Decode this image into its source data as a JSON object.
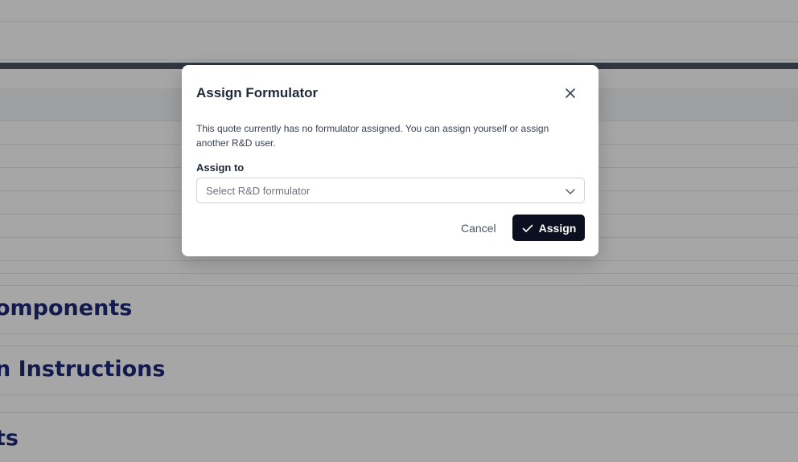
{
  "background": {
    "section_headings": [
      "omponents",
      "n Instructions",
      "ts"
    ]
  },
  "modal": {
    "title": "Assign Formulator",
    "description": "This quote currently has no formulator assigned. You can assign yourself or assign another R&D user.",
    "field_label": "Assign to",
    "select_placeholder": "Select R&D formulator",
    "cancel_label": "Cancel",
    "assign_label": "Assign",
    "close_icon": "close-icon",
    "chevron_icon": "chevron-down-icon",
    "check_icon": "check-icon"
  },
  "colors": {
    "primary_button": "#0b0f1f",
    "heading": "#1e2a78",
    "overlay": "rgba(0,0,0,0.35)"
  }
}
